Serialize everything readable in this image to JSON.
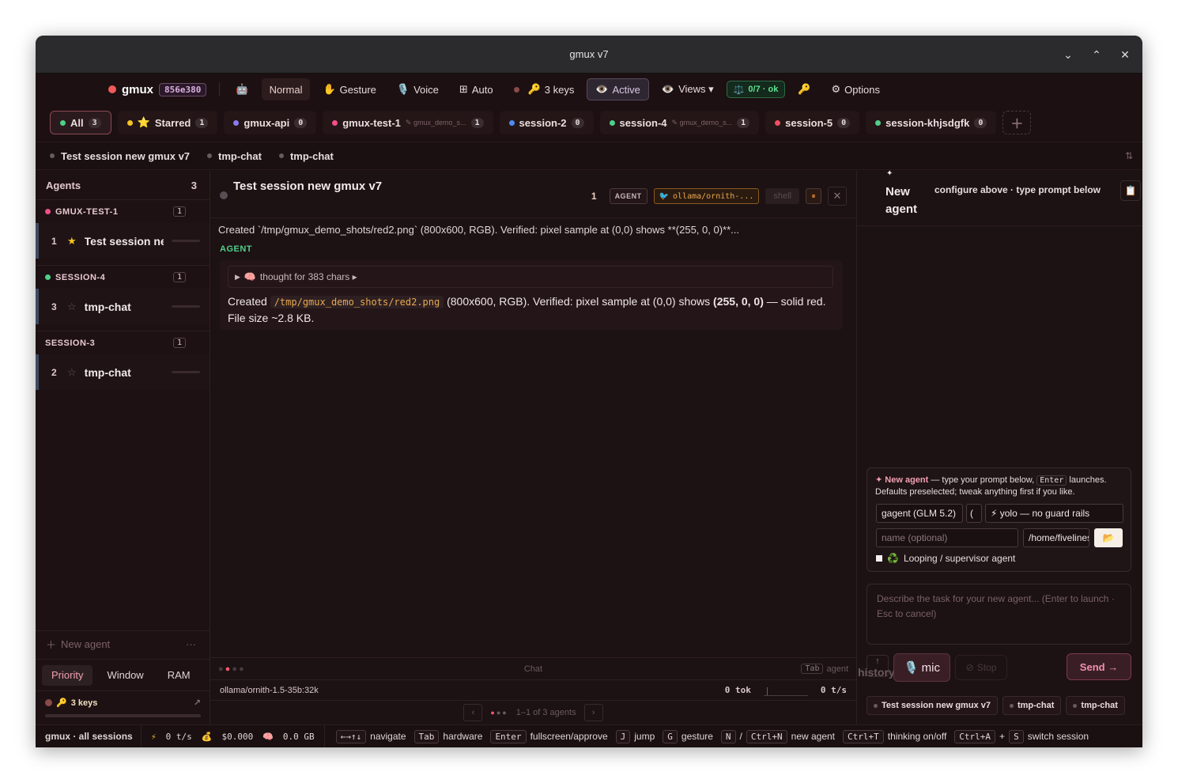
{
  "window": {
    "title": "gmux v7"
  },
  "toolbar": {
    "brand": "gmux",
    "hash": "856e380",
    "robot_icon": "robot-icon",
    "mode": "Normal",
    "gesture": "Gesture",
    "voice": "Voice",
    "auto": "Auto",
    "keys": "3 keys",
    "active": "Active",
    "views": "Views ▾",
    "ok": "0/7 · ok",
    "options": "Options"
  },
  "session_tabs": [
    {
      "label": "All",
      "count": "3",
      "color": "#4fcf8a"
    },
    {
      "label": "Starred",
      "count": "1",
      "color": "#f3c423"
    },
    {
      "label": "gmux-api",
      "count": "0",
      "color": "#8a7cf0"
    },
    {
      "label": "gmux-test-1",
      "tag": "gmux_demo_s...",
      "count": "1",
      "color": "#f04f8a"
    },
    {
      "label": "session-2",
      "count": "0",
      "color": "#4f8af0"
    },
    {
      "label": "session-4",
      "tag": "gmux_demo_s...",
      "count": "1",
      "color": "#4fcf8a"
    },
    {
      "label": "session-5",
      "count": "0",
      "color": "#f04f5f"
    },
    {
      "label": "session-khjsdgfk",
      "count": "0",
      "color": "#4fcf8a"
    }
  ],
  "pane_tabs": [
    "Test session new gmux v7",
    "tmp-chat",
    "tmp-chat"
  ],
  "sidebar": {
    "title": "Agents",
    "count": "3",
    "groups": [
      {
        "name": "GMUX-TEST-1",
        "count": "1",
        "color": "#f04f8a",
        "item": {
          "num": "1",
          "label": "Test session ne...",
          "starred": true
        }
      },
      {
        "name": "SESSION-4",
        "count": "1",
        "color": "#4fcf8a",
        "item": {
          "num": "3",
          "label": "tmp-chat",
          "starred": false
        }
      },
      {
        "name": "SESSION-3",
        "count": "1",
        "color": "",
        "item": {
          "num": "2",
          "label": "tmp-chat",
          "starred": false
        }
      }
    ],
    "new_agent": "New agent",
    "more": "···",
    "sort_tabs": [
      "Priority",
      "Window",
      "RAM"
    ],
    "keys": "3 keys",
    "keys_arrow": "↗"
  },
  "main": {
    "title": "Test session new gmux v7",
    "count": "1",
    "agent_chip": "AGENT",
    "model_chip": "ollama/ornith-...",
    "shell": "shell",
    "pause": "⏸",
    "close": "✕",
    "summary": "Created `/tmp/gmux_demo_shots/red2.png` (800x600, RGB). Verified: pixel sample at (0,0) shows **(255, 0, 0)**...",
    "agent_label": "AGENT",
    "thought": "thought for 383 chars ▸",
    "body_pre": "Created ",
    "body_code": "/tmp/gmux_demo_shots/red2.png",
    "body_mid": " (800x600, RGB). Verified: pixel sample at (0,0) shows ",
    "body_bold": "(255, 0, 0)",
    "body_post": " — solid red. File size ~2.8 KB.",
    "strip_center": "Chat",
    "strip_kbd": "Tab",
    "strip_right": "agent",
    "model": "ollama/ornith-1.5-35b:32k",
    "tok": "0 tok",
    "tps": "0 t/s",
    "pager_prev": "‹",
    "pager_next": "›",
    "pager_text": "1–1 of 3 agents"
  },
  "right": {
    "spark": "✦",
    "title": "New agent",
    "subtitle": "configure above · type prompt below",
    "intro_bold": "✦ New agent",
    "intro_a": " — type your prompt below, ",
    "intro_kbd": "Enter",
    "intro_b": " launches. Defaults preselected; tweak anything first if you like.",
    "model_field": "gagent (GLM 5.2)",
    "small_field": "(",
    "mode_field": "⚡ yolo — no guard rails",
    "name_placeholder": "name (optional)",
    "path_field": "/home/fivelines",
    "loop": "Looping / supervisor agent",
    "prompt_placeholder": "Describe the task for your new agent... (Enter to launch · Esc to cancel)",
    "history": "history",
    "history_arrow": "↑",
    "mic": "mic",
    "stop": "Stop",
    "send": "Send →",
    "tabs": [
      "Test session new gmux v7",
      "tmp-chat",
      "tmp-chat"
    ]
  },
  "statusbar": {
    "scope": "gmux · all sessions",
    "tps": "0 t/s",
    "cost": "$0.000",
    "mem": "0.0 GB",
    "hints": [
      {
        "keys": [
          "←→↑↓"
        ],
        "label": "navigate"
      },
      {
        "keys": [
          "Tab"
        ],
        "label": "hardware"
      },
      {
        "keys": [
          "Enter"
        ],
        "label": "fullscreen/approve"
      },
      {
        "keys": [
          "J"
        ],
        "label": "jump"
      },
      {
        "keys": [
          "G"
        ],
        "label": "gesture"
      },
      {
        "keys": [
          "N",
          "Ctrl+N"
        ],
        "sep": "/",
        "label": "new agent"
      },
      {
        "keys": [
          "Ctrl+T"
        ],
        "label": "thinking on/off"
      },
      {
        "keys": [
          "Ctrl+A",
          "S"
        ],
        "sep": "+",
        "label": "switch session"
      }
    ]
  }
}
